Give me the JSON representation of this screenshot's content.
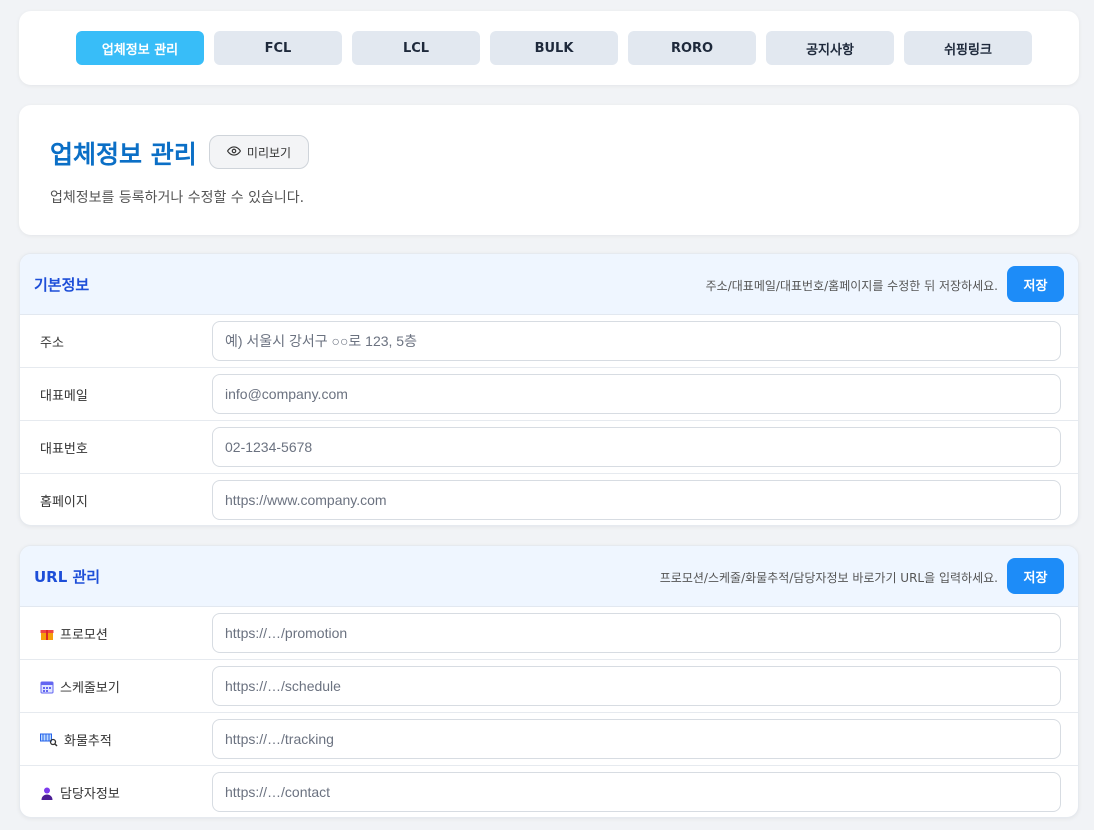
{
  "nav": {
    "tabs": [
      "업체정보 관리",
      "FCL",
      "LCL",
      "BULK",
      "RORO",
      "공지사항",
      "쉬핑링크"
    ],
    "active_index": 0
  },
  "header": {
    "title": "업체정보 관리",
    "preview_label": "미리보기",
    "description": "업체정보를 등록하거나 수정할 수 있습니다."
  },
  "basic": {
    "title": "기본정보",
    "hint": "주소/대표메일/대표번호/홈페이지를 수정한 뒤 저장하세요.",
    "save_label": "저장",
    "rows": [
      {
        "label": "주소",
        "placeholder": "예) 서울시 강서구 ○○로 123, 5층",
        "value": ""
      },
      {
        "label": "대표메일",
        "placeholder": "info@company.com",
        "value": ""
      },
      {
        "label": "대표번호",
        "placeholder": "02-1234-5678",
        "value": ""
      },
      {
        "label": "홈페이지",
        "placeholder": "https://www.company.com",
        "value": ""
      }
    ]
  },
  "url": {
    "title": "URL 관리",
    "hint": "프로모션/스케줄/화물추적/담당자정보 바로가기 URL을 입력하세요.",
    "save_label": "저장",
    "rows": [
      {
        "label": "프로모션",
        "icon": "gift-icon",
        "placeholder": "https://…/promotion",
        "value": ""
      },
      {
        "label": "스케줄보기",
        "icon": "calendar-icon",
        "placeholder": "https://…/schedule",
        "value": ""
      },
      {
        "label": "화물추적",
        "icon": "container-search-icon",
        "placeholder": "https://…/tracking",
        "value": ""
      },
      {
        "label": "담당자정보",
        "icon": "person-icon",
        "placeholder": "https://…/contact",
        "value": ""
      }
    ]
  },
  "colors": {
    "accent": "#38bdf8",
    "title_blue": "#0b6fc6",
    "save_blue": "#1d8cf8"
  }
}
